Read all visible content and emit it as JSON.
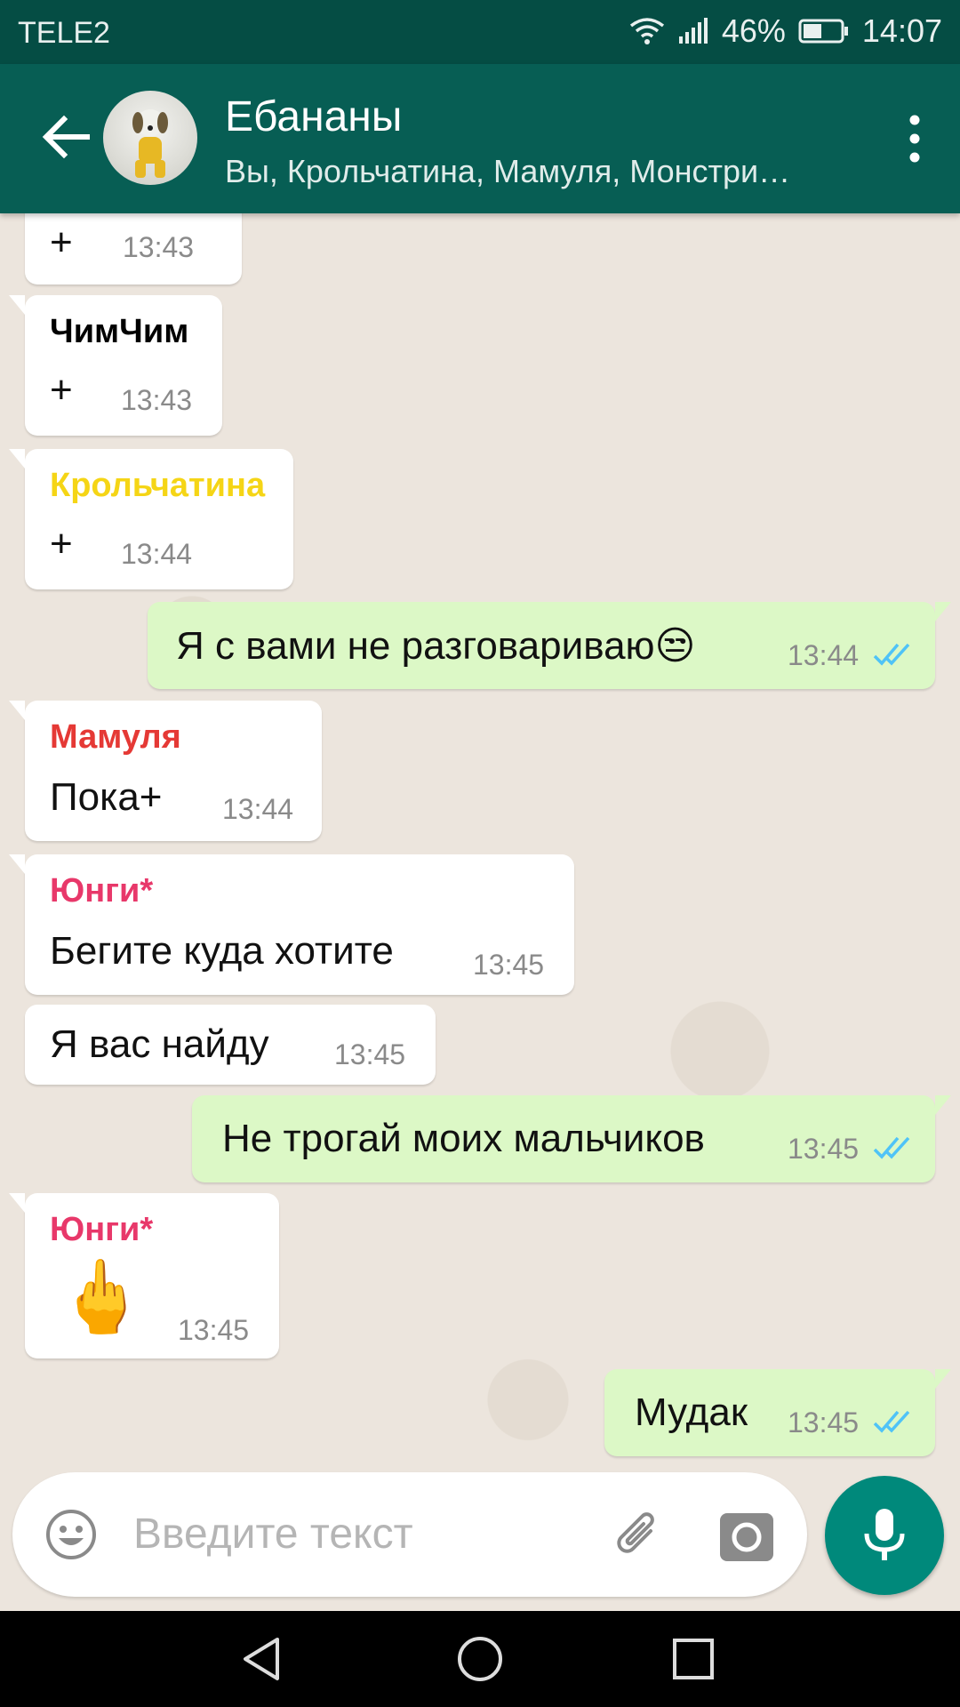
{
  "status_bar": {
    "carrier": "TELE2",
    "battery_percent": "46%",
    "time": "14:07"
  },
  "header": {
    "title": "Ебананы",
    "subtitle": "Вы, Крольчатина, Мамуля, Монстри…"
  },
  "messages": [
    {
      "direction": "in",
      "sender": "",
      "text": "+",
      "time": "13:43"
    },
    {
      "direction": "in",
      "sender": "ЧимЧим",
      "sender_color": "#000000",
      "text": "+",
      "time": "13:43"
    },
    {
      "direction": "in",
      "sender": "Крольчатина",
      "sender_color": "#f5d516",
      "text": "+",
      "time": "13:44"
    },
    {
      "direction": "out",
      "text": "Я с вами не разговариваю😒",
      "time": "13:44",
      "status": "read"
    },
    {
      "direction": "in",
      "sender": "Мамуля",
      "sender_color": "#e53935",
      "text": "Пока+",
      "time": "13:44"
    },
    {
      "direction": "in",
      "sender": "Юнги*",
      "sender_color": "#e8386a",
      "text": "Бегите куда хотите",
      "time": "13:45"
    },
    {
      "direction": "in",
      "sender": "",
      "text": "Я вас найду",
      "time": "13:45"
    },
    {
      "direction": "out",
      "text": "Не трогай моих мальчиков",
      "time": "13:45",
      "status": "read"
    },
    {
      "direction": "in",
      "sender": "Юнги*",
      "sender_color": "#e8386a",
      "text": "🖕",
      "time": "13:45"
    },
    {
      "direction": "out",
      "text": "Мудак",
      "time": "13:45",
      "status": "read"
    }
  ],
  "composer": {
    "placeholder": "Введите текст"
  },
  "icons": {
    "back": "arrow-left-icon",
    "menu": "more-vert-icon",
    "emoji": "smiley-icon",
    "attach": "paperclip-icon",
    "camera": "camera-icon",
    "mic": "microphone-icon"
  },
  "colors": {
    "header": "#075e54",
    "status_bar": "#054d44",
    "outgoing_bubble": "#dcf8c6",
    "incoming_bubble": "#ffffff",
    "read_ticks": "#4fc3f7",
    "fab": "#00897b"
  }
}
